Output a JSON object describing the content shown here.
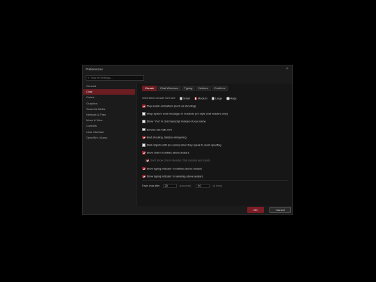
{
  "window": {
    "title": "Preferences",
    "close_glyph": "×"
  },
  "search": {
    "placeholder": "Search Settings..."
  },
  "sidebar": {
    "items": [
      {
        "label": "General",
        "active": false
      },
      {
        "label": "Chat",
        "active": true
      },
      {
        "label": "Colors",
        "active": false
      },
      {
        "label": "Graphics",
        "active": false
      },
      {
        "label": "Sound & Media",
        "active": false
      },
      {
        "label": "Network & Files",
        "active": false
      },
      {
        "label": "Move & View",
        "active": false
      },
      {
        "label": "Controls",
        "active": false
      },
      {
        "label": "User Interface",
        "active": false
      },
      {
        "label": "OpenSim / Aurus",
        "active": false
      }
    ]
  },
  "tabs": [
    {
      "label": "Visuals",
      "active": true
    },
    {
      "label": "Chat Windows",
      "active": false
    },
    {
      "label": "Typing",
      "active": false
    },
    {
      "label": "Notices",
      "active": false
    },
    {
      "label": "CmdLine",
      "active": false
    }
  ],
  "font_size": {
    "label": "Greenwich console font size:",
    "options": [
      "Small",
      "Medium",
      "Large",
      "Huge"
    ],
    "selected": "Medium"
  },
  "options": [
    {
      "label": "Play avatar animations (such as shouting)",
      "checked": true,
      "disabled": false,
      "indent": false
    },
    {
      "label": "Wrap system chat messages in brackets (V1-style chat headers only)",
      "checked": false,
      "disabled": false,
      "indent": false
    },
    {
      "label": "Show \"You\" in chat transcript instead of your name",
      "checked": false,
      "disabled": false,
      "indent": false
    },
    {
      "label": "Emotes use italic font",
      "checked": false,
      "disabled": false,
      "indent": false
    },
    {
      "label": "Bold shouting, Italicize whispering",
      "checked": true,
      "disabled": false,
      "indent": false
    },
    {
      "label": "Mark objects with (no name) when they speak to avoid spoofing",
      "checked": false,
      "disabled": false,
      "indent": false
    },
    {
      "label": "Show chat in bubbles above avatars",
      "checked": true,
      "disabled": false,
      "indent": false
    },
    {
      "label": "Don't show chat in Nearby Chat console and toasts",
      "checked": true,
      "disabled": true,
      "indent": true
    },
    {
      "label": "Show typing indicator in bubbles above avatars",
      "checked": true,
      "disabled": false,
      "indent": false
    },
    {
      "label": "Show typing indicator in nametag above avatars",
      "checked": true,
      "disabled": false,
      "indent": false
    }
  ],
  "fade": {
    "label": "Fade chat after",
    "seconds_value": "20",
    "seconds_unit": "(seconds)",
    "lines_value": "40",
    "lines_unit": "(# lines)"
  },
  "buttons": {
    "ok": "OK",
    "cancel": "Cancel"
  },
  "colors": {
    "accent": "#8e2027",
    "active_bg": "#6b1d22",
    "dialog_bg": "#1b1b1b"
  }
}
